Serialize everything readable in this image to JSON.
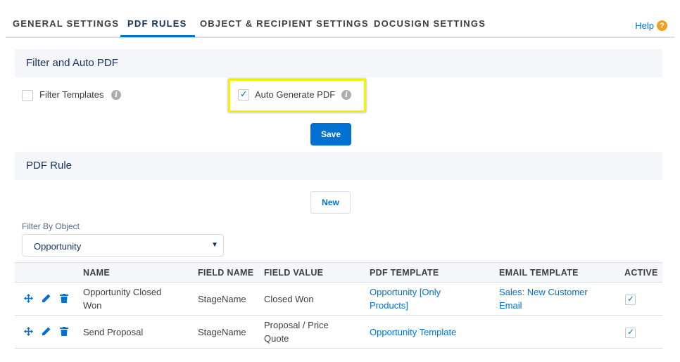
{
  "tabs": [
    {
      "label": "GENERAL SETTINGS"
    },
    {
      "label": "PDF RULES",
      "active": true
    },
    {
      "label": "OBJECT & RECIPIENT SETTINGS"
    },
    {
      "label": "DOCUSIGN SETTINGS"
    }
  ],
  "help": {
    "label": "Help",
    "icon": "?"
  },
  "filter_section": {
    "title": "Filter and Auto PDF",
    "filter_templates": {
      "label": "Filter Templates",
      "checked": false
    },
    "auto_generate": {
      "label": "Auto Generate PDF",
      "checked": true
    },
    "save_label": "Save"
  },
  "rule_section": {
    "title": "PDF Rule",
    "new_label": "New",
    "filter_by": {
      "label": "Filter By Object",
      "value": "Opportunity"
    }
  },
  "table": {
    "headers": [
      "NAME",
      "FIELD NAME",
      "FIELD VALUE",
      "PDF TEMPLATE",
      "EMAIL TEMPLATE",
      "ACTIVE"
    ],
    "rows": [
      {
        "name": [
          "Opportunity Closed",
          "Won"
        ],
        "field_name": "StageName",
        "field_value": [
          "Closed Won"
        ],
        "pdf_template": [
          "Opportunity [Only",
          "Products]"
        ],
        "email_template": [
          "Sales: New Customer",
          "Email"
        ],
        "active": true
      },
      {
        "name": [
          "Send Proposal"
        ],
        "field_name": "StageName",
        "field_value": [
          "Proposal / Price",
          "Quote"
        ],
        "pdf_template": [
          "Opportunity Template"
        ],
        "email_template": [],
        "active": true
      }
    ]
  },
  "colors": {
    "brand": "#0070d2",
    "help": "#f59d1e",
    "highlight": "#f2f200"
  }
}
